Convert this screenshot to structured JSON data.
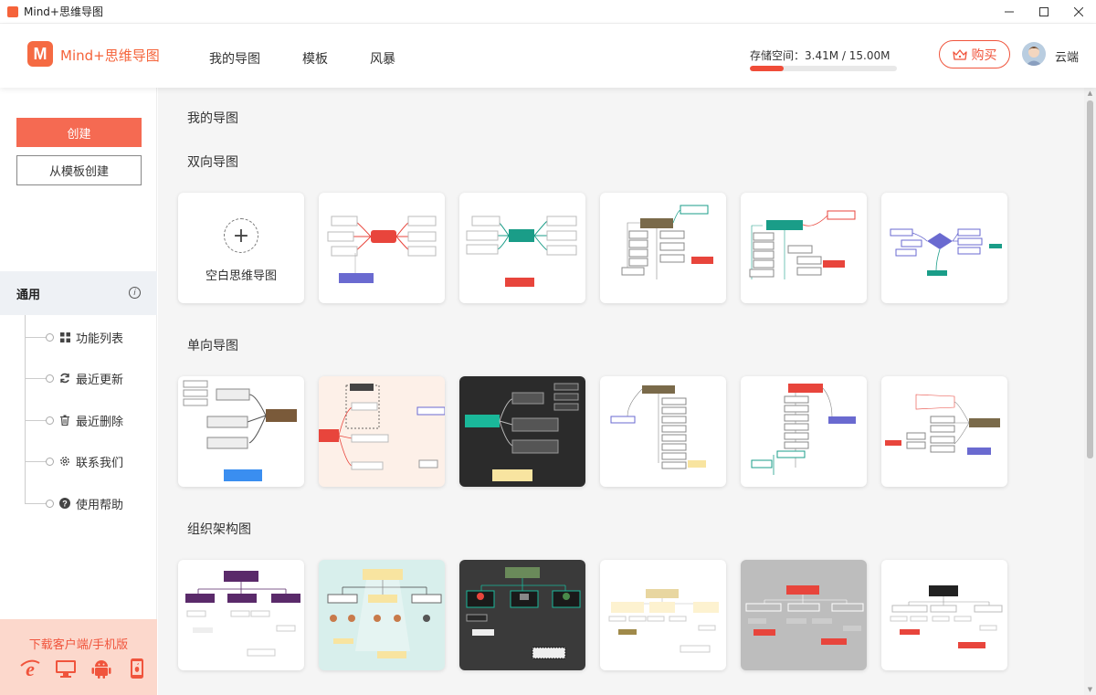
{
  "window": {
    "title": "Mind+思维导图"
  },
  "header": {
    "logo_letter": "M",
    "brand": "Mind+思维导图",
    "nav": [
      {
        "label": "我的导图"
      },
      {
        "label": "模板"
      },
      {
        "label": "风暴"
      }
    ],
    "storage_label": "存储空间：3.41M / 15.00M",
    "storage_used_fraction": 0.227,
    "buy_label": "购买",
    "username": "云端"
  },
  "sidebar": {
    "create_label": "创建",
    "from_template_label": "从模板创建",
    "section_title": "通用",
    "info_glyph": "i",
    "items": [
      {
        "label": "功能列表",
        "icon": "grid-icon"
      },
      {
        "label": "最近更新",
        "icon": "refresh-icon"
      },
      {
        "label": "最近删除",
        "icon": "trash-icon"
      },
      {
        "label": "联系我们",
        "icon": "gear-icon"
      },
      {
        "label": "使用帮助",
        "icon": "help-icon"
      }
    ],
    "download_label": "下载客户端/手机版"
  },
  "main": {
    "title": "我的导图",
    "blank_label": "空白思维导图",
    "categories": [
      {
        "title": "双向导图"
      },
      {
        "title": "单向导图"
      },
      {
        "title": "组织架构图"
      }
    ]
  },
  "colors": {
    "accent": "#f5633a",
    "create_button": "#f56a52",
    "download_bg": "#fcd8cc"
  }
}
